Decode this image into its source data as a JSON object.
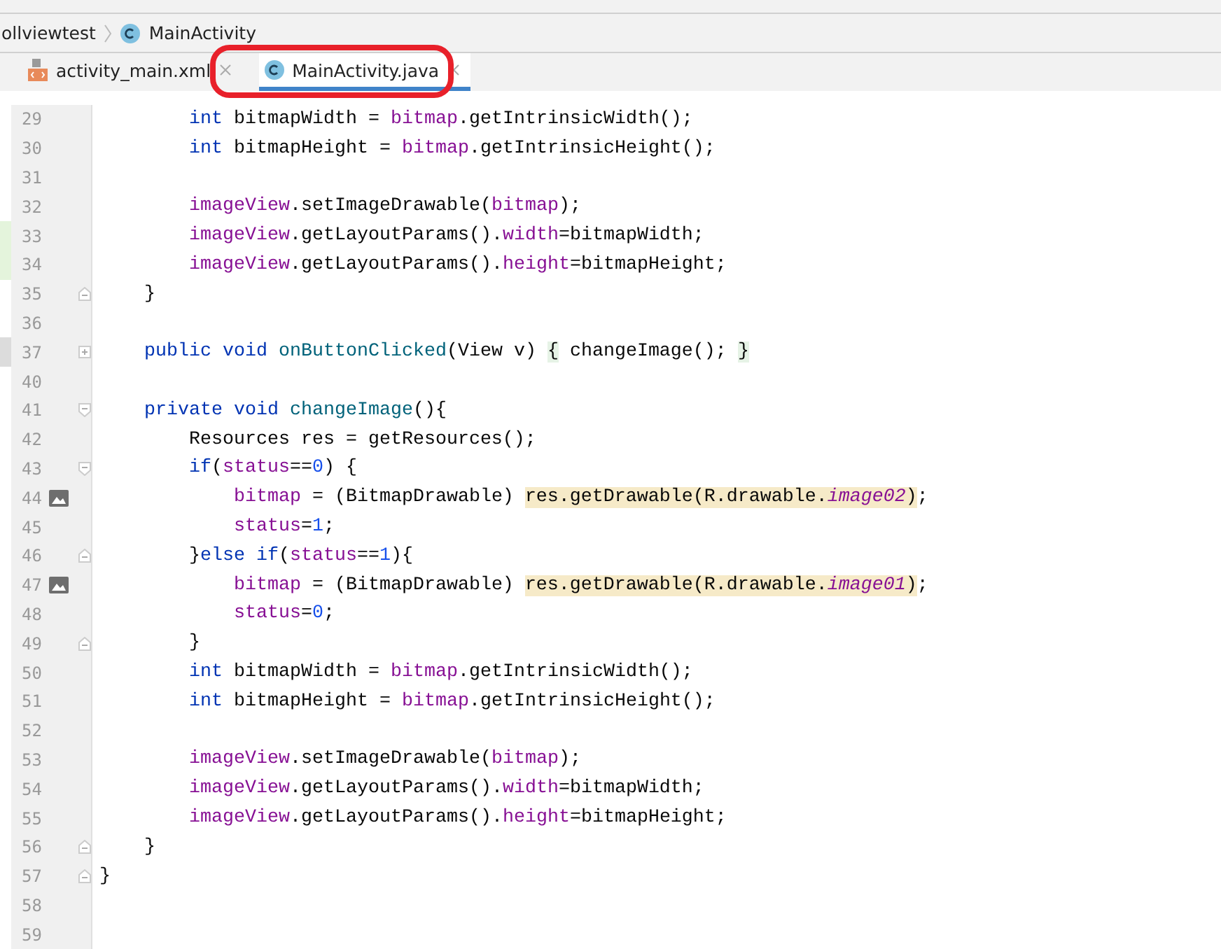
{
  "breadcrumb": [
    "ollviewtest",
    "MainActivity"
  ],
  "tabs": [
    {
      "label": "activity_main.xml",
      "kind": "xml",
      "selected": false
    },
    {
      "label": "MainActivity.java",
      "kind": "class",
      "selected": true
    }
  ],
  "lines": [
    {
      "number": "29",
      "tokens": [
        {
          "t": "        int",
          "kind": "keyword"
        },
        {
          "t": " bitmapWidth = "
        },
        {
          "t": "bitmap",
          "kind": "field"
        },
        {
          "t": ".getIntrinsicWidth();"
        }
      ]
    },
    {
      "number": "30",
      "tokens": [
        {
          "t": "        int",
          "kind": "keyword"
        },
        {
          "t": " bitmapHeight = "
        },
        {
          "t": "bitmap",
          "kind": "field"
        },
        {
          "t": ".getIntrinsicHeight();"
        }
      ]
    },
    {
      "number": "31"
    },
    {
      "number": "32",
      "tokens": [
        {
          "t": "        imageView",
          "kind": "field"
        },
        {
          "t": ".setImageDrawable("
        },
        {
          "t": "bitmap",
          "kind": "field"
        },
        {
          "t": ");"
        }
      ]
    },
    {
      "number": "33",
      "changed": true,
      "tokens": [
        {
          "t": "        imageView",
          "kind": "field"
        },
        {
          "t": ".getLayoutParams()."
        },
        {
          "t": "width",
          "kind": "field"
        },
        {
          "t": "=bitmapWidth;"
        }
      ]
    },
    {
      "number": "34",
      "changed": true,
      "tokens": [
        {
          "t": "        imageView",
          "kind": "field"
        },
        {
          "t": ".getLayoutParams()."
        },
        {
          "t": "height",
          "kind": "field"
        },
        {
          "t": "=bitmapHeight;"
        }
      ]
    },
    {
      "number": "35",
      "kind": "fold_end",
      "tokens": [
        {
          "t": "    }"
        }
      ]
    },
    {
      "number": "36"
    },
    {
      "number": "37",
      "kind": "folded",
      "marked": true,
      "tokens": [
        {
          "t": "    public void",
          "kind": "keyword"
        },
        {
          "t": " onButtonClicked",
          "kind": "declaration"
        },
        {
          "t": "(View v) "
        },
        {
          "t": "{",
          "kind": "fold_brace"
        },
        {
          "t": " changeImage(); "
        },
        {
          "t": "}",
          "kind": "fold_brace"
        }
      ]
    },
    {
      "number": "40"
    },
    {
      "number": "41",
      "kind": "fold_start",
      "tokens": [
        {
          "t": "    private void",
          "kind": "keyword"
        },
        {
          "t": " changeImage",
          "kind": "declaration"
        },
        {
          "t": "(){"
        }
      ]
    },
    {
      "number": "42",
      "tokens": [
        {
          "t": "        Resources res = getResources();"
        }
      ]
    },
    {
      "number": "43",
      "kind": "fold_start",
      "tokens": [
        {
          "t": "        if",
          "kind": "keyword"
        },
        {
          "t": "("
        },
        {
          "t": "status",
          "kind": "field"
        },
        {
          "t": "=="
        },
        {
          "t": "0",
          "kind": "number"
        },
        {
          "t": ") {"
        }
      ]
    },
    {
      "number": "44",
      "kind": "image",
      "tokens": [
        {
          "t": "            bitmap",
          "kind": "field"
        },
        {
          "t": " = (BitmapDrawable) "
        },
        {
          "t": "res.getDrawable(R.drawable.",
          "kind": "usage"
        },
        {
          "t": "image02",
          "kind": "usage_static"
        },
        {
          "t": ")",
          "kind": "usage"
        },
        {
          "t": ";"
        }
      ]
    },
    {
      "number": "45",
      "tokens": [
        {
          "t": "            status",
          "kind": "field"
        },
        {
          "t": "="
        },
        {
          "t": "1",
          "kind": "number"
        },
        {
          "t": ";"
        }
      ]
    },
    {
      "number": "46",
      "kind": "fold_end",
      "tokens": [
        {
          "t": "        }"
        },
        {
          "t": "else if",
          "kind": "keyword"
        },
        {
          "t": "("
        },
        {
          "t": "status",
          "kind": "field"
        },
        {
          "t": "=="
        },
        {
          "t": "1",
          "kind": "number"
        },
        {
          "t": "){"
        }
      ]
    },
    {
      "number": "47",
      "kind": "image",
      "tokens": [
        {
          "t": "            bitmap",
          "kind": "field"
        },
        {
          "t": " = (BitmapDrawable) "
        },
        {
          "t": "res.getDrawable(R.drawable.",
          "kind": "usage"
        },
        {
          "t": "image01",
          "kind": "usage_static"
        },
        {
          "t": ")",
          "kind": "usage"
        },
        {
          "t": ";"
        }
      ]
    },
    {
      "number": "48",
      "tokens": [
        {
          "t": "            status",
          "kind": "field"
        },
        {
          "t": "="
        },
        {
          "t": "0",
          "kind": "number"
        },
        {
          "t": ";"
        }
      ]
    },
    {
      "number": "49",
      "kind": "fold_end",
      "tokens": [
        {
          "t": "        }"
        }
      ]
    },
    {
      "number": "50",
      "tokens": [
        {
          "t": "        int",
          "kind": "keyword"
        },
        {
          "t": " bitmapWidth = "
        },
        {
          "t": "bitmap",
          "kind": "field"
        },
        {
          "t": ".getIntrinsicWidth();"
        }
      ]
    },
    {
      "number": "51",
      "tokens": [
        {
          "t": "        int",
          "kind": "keyword"
        },
        {
          "t": " bitmapHeight = "
        },
        {
          "t": "bitmap",
          "kind": "field"
        },
        {
          "t": ".getIntrinsicHeight();"
        }
      ]
    },
    {
      "number": "52"
    },
    {
      "number": "53",
      "tokens": [
        {
          "t": "        imageView",
          "kind": "field"
        },
        {
          "t": ".setImageDrawable("
        },
        {
          "t": "bitmap",
          "kind": "field"
        },
        {
          "t": ");"
        }
      ]
    },
    {
      "number": "54",
      "tokens": [
        {
          "t": "        imageView",
          "kind": "field"
        },
        {
          "t": ".getLayoutParams()."
        },
        {
          "t": "width",
          "kind": "field"
        },
        {
          "t": "=bitmapWidth;"
        }
      ]
    },
    {
      "number": "55",
      "tokens": [
        {
          "t": "        imageView",
          "kind": "field"
        },
        {
          "t": ".getLayoutParams()."
        },
        {
          "t": "height",
          "kind": "field"
        },
        {
          "t": "=bitmapHeight;"
        }
      ]
    },
    {
      "number": "56",
      "kind": "fold_end",
      "tokens": [
        {
          "t": "    }"
        }
      ]
    },
    {
      "number": "57",
      "kind": "fold_end",
      "tokens": [
        {
          "t": "}"
        }
      ]
    },
    {
      "number": "58"
    },
    {
      "number": "59"
    }
  ]
}
